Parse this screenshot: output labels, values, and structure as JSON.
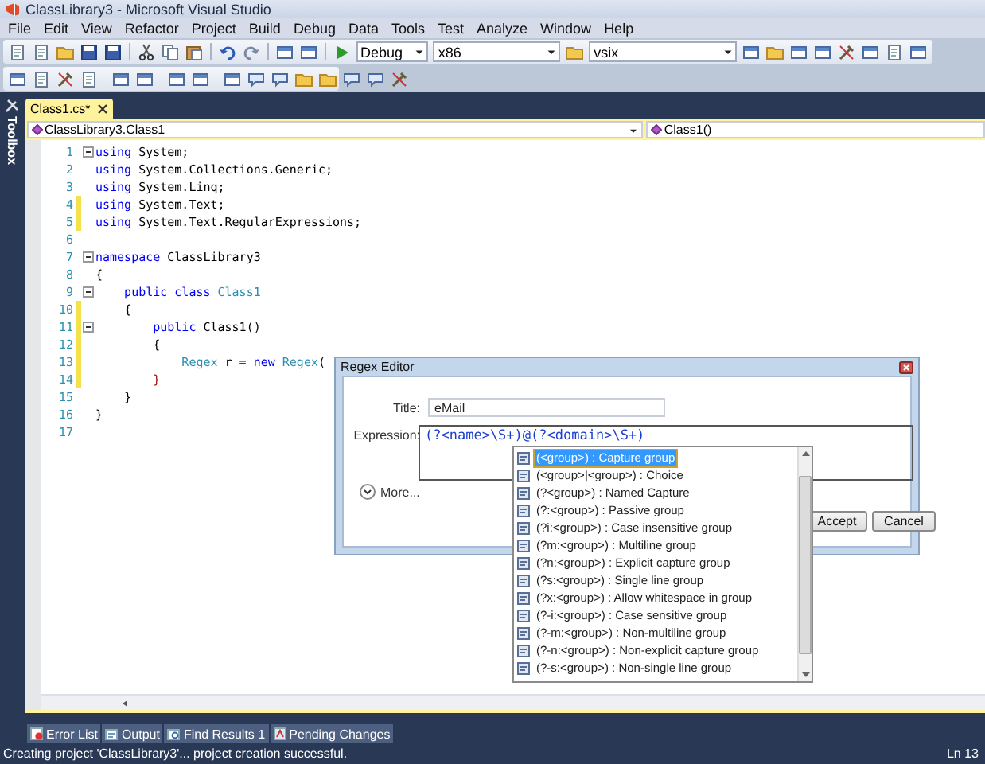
{
  "window": {
    "title": "ClassLibrary3 - Microsoft Visual Studio"
  },
  "menu": [
    "File",
    "Edit",
    "View",
    "Refactor",
    "Project",
    "Build",
    "Debug",
    "Data",
    "Tools",
    "Test",
    "Analyze",
    "Window",
    "Help"
  ],
  "toolbar": {
    "configuration": "Debug",
    "platform": "x86",
    "find": "vsix"
  },
  "toolbox": {
    "label": "Toolbox"
  },
  "document_tabs": [
    {
      "label": "Class1.cs*",
      "selected": true
    }
  ],
  "navigation": {
    "type_combo": "ClassLibrary3.Class1",
    "member_combo": "Class1()"
  },
  "code_lines": [
    {
      "number": "1",
      "changed": false,
      "collapsible": true,
      "tokens": [
        {
          "kind": "keyword",
          "text": "using"
        },
        {
          "kind": "plain",
          "text": " System;"
        }
      ]
    },
    {
      "number": "2",
      "changed": false,
      "collapsible": false,
      "tokens": [
        {
          "kind": "keyword",
          "text": "using"
        },
        {
          "kind": "plain",
          "text": " System.Collections.Generic;"
        }
      ]
    },
    {
      "number": "3",
      "changed": false,
      "collapsible": false,
      "tokens": [
        {
          "kind": "keyword",
          "text": "using"
        },
        {
          "kind": "plain",
          "text": " System.Linq;"
        }
      ]
    },
    {
      "number": "4",
      "changed": true,
      "collapsible": false,
      "tokens": [
        {
          "kind": "keyword",
          "text": "using"
        },
        {
          "kind": "plain",
          "text": " System.Text;"
        }
      ]
    },
    {
      "number": "5",
      "changed": true,
      "collapsible": false,
      "tokens": [
        {
          "kind": "keyword",
          "text": "using"
        },
        {
          "kind": "plain",
          "text": " System.Text.RegularExpressions;"
        }
      ]
    },
    {
      "number": "6",
      "changed": false,
      "collapsible": false
    },
    {
      "number": "7",
      "changed": false,
      "collapsible": true,
      "tokens": [
        {
          "kind": "keyword",
          "text": "namespace"
        },
        {
          "kind": "plain",
          "text": " ClassLibrary3"
        }
      ]
    },
    {
      "number": "8",
      "changed": false,
      "collapsible": false,
      "tokens": [
        {
          "kind": "plain",
          "text": "{"
        }
      ]
    },
    {
      "number": "9",
      "changed": false,
      "collapsible": true,
      "tokens": [
        {
          "kind": "keyword",
          "text": "    public class"
        },
        {
          "kind": "type",
          "text": " Class1"
        }
      ]
    },
    {
      "number": "10",
      "changed": true,
      "collapsible": false,
      "tokens": [
        {
          "kind": "plain",
          "text": "    {"
        }
      ]
    },
    {
      "number": "11",
      "changed": true,
      "collapsible": true,
      "tokens": [
        {
          "kind": "keyword",
          "text": "        public"
        },
        {
          "kind": "plain",
          "text": " Class1()"
        }
      ]
    },
    {
      "number": "12",
      "changed": true,
      "collapsible": false,
      "tokens": [
        {
          "kind": "plain",
          "text": "        {"
        }
      ]
    },
    {
      "number": "13",
      "changed": true,
      "collapsible": false,
      "tokens": [
        {
          "kind": "type",
          "text": "            Regex"
        },
        {
          "kind": "plain",
          "text": " r = "
        },
        {
          "kind": "keyword",
          "text": "new"
        },
        {
          "kind": "type",
          "text": " Regex"
        },
        {
          "kind": "plain",
          "text": "("
        }
      ]
    },
    {
      "number": "14",
      "changed": true,
      "collapsible": false,
      "tokens": [
        {
          "kind": "brace-match",
          "text": "        }"
        }
      ]
    },
    {
      "number": "15",
      "changed": false,
      "collapsible": false,
      "tokens": [
        {
          "kind": "plain",
          "text": "    }"
        }
      ]
    },
    {
      "number": "16",
      "changed": false,
      "collapsible": false,
      "tokens": [
        {
          "kind": "plain",
          "text": "}"
        }
      ]
    },
    {
      "number": "17",
      "changed": false,
      "collapsible": false
    }
  ],
  "dialog": {
    "title": "Regex Editor",
    "title_label": "Title:",
    "title_value": "eMail",
    "expression_label": "Expression:",
    "expression_value": "(?<name>\\S+)@(?<domain>\\S+)",
    "more": "More...",
    "buttons": [
      "Accept",
      "Cancel"
    ]
  },
  "completion": [
    {
      "text": "(<group>) : Capture group",
      "selected": true
    },
    {
      "text": "(<group>|<group>) : Choice",
      "selected": false
    },
    {
      "text": "(?<group>) : Named Capture",
      "selected": false
    },
    {
      "text": "(?:<group>) : Passive group",
      "selected": false
    },
    {
      "text": "(?i:<group>) : Case insensitive group",
      "selected": false
    },
    {
      "text": "(?m:<group>) : Multiline group",
      "selected": false
    },
    {
      "text": "(?n:<group>) : Explicit capture group",
      "selected": false
    },
    {
      "text": "(?s:<group>) : Single line group",
      "selected": false
    },
    {
      "text": "(?x:<group>) : Allow whitespace in group",
      "selected": false
    },
    {
      "text": "(?-i:<group>) : Case sensitive group",
      "selected": false
    },
    {
      "text": "(?-m:<group>) : Non-multiline group",
      "selected": false
    },
    {
      "text": "(?-n:<group>) : Non-explicit capture group",
      "selected": false
    },
    {
      "text": "(?-s:<group>) : Non-single line group",
      "selected": false
    }
  ],
  "bottom_tabs": [
    "Error List",
    "Output",
    "Find Results 1",
    "Pending Changes"
  ],
  "status_bar": {
    "message": "Creating project 'ClassLibrary3'... project creation successful.",
    "position": "Ln 13"
  }
}
